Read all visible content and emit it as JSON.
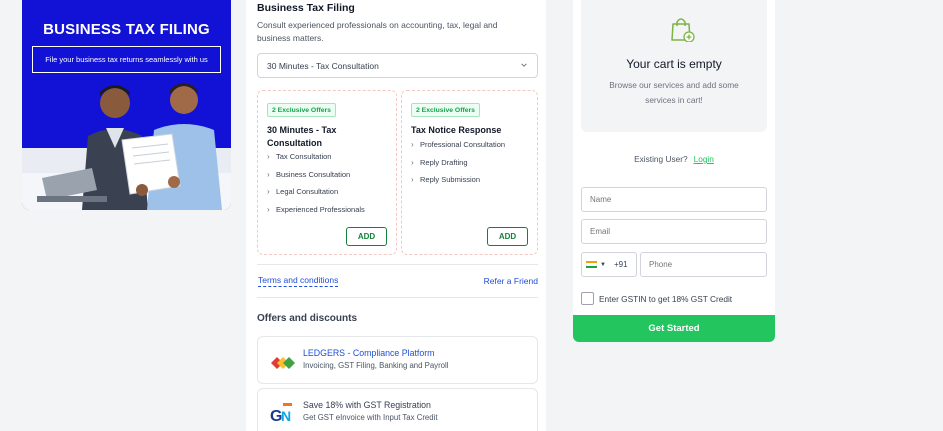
{
  "hero": {
    "title": "BUSINESS TAX FILING",
    "subtitle": "File your business tax returns seamlessly with us"
  },
  "service": {
    "title": "Business Tax Filing",
    "description": "Consult experienced professionals on accounting, tax, legal and business matters.",
    "selected_option": "30 Minutes - Tax Consultation"
  },
  "offer_cards": [
    {
      "badge": "2 Exclusive Offers",
      "title": "30 Minutes - Tax Consultation",
      "items": [
        "Tax Consultation",
        "Business Consultation",
        "Legal Consultation",
        "Experienced Professionals"
      ],
      "button": "ADD"
    },
    {
      "badge": "2 Exclusive Offers",
      "title": "Tax Notice Response",
      "items": [
        "Professional Consultation",
        "Reply Drafting",
        "Reply Submission"
      ],
      "button": "ADD"
    }
  ],
  "links": {
    "terms": "Terms and conditions",
    "refer": "Refer a Friend"
  },
  "offers": {
    "heading": "Offers and discounts",
    "items": [
      {
        "title": "LEDGERS - Compliance Platform",
        "subtitle": "Invoicing, GST Filing, Banking and Payroll",
        "icon": "ledgers-logo-icon"
      },
      {
        "title": "Save 18% with GST Registration",
        "subtitle": "Get GST eInvoice with Input Tax Credit",
        "icon": "gst-logo-icon"
      }
    ]
  },
  "cart": {
    "title": "Your cart is empty",
    "subtitle": "Browse our services and add some services in cart!",
    "icon": "shopping-bag-plus-icon"
  },
  "form": {
    "existing_user": "Existing User?",
    "login": "Login",
    "name_placeholder": "Name",
    "email_placeholder": "Email",
    "country_code": "+91",
    "phone_placeholder": "Phone",
    "gst_label": "Enter GSTIN to get 18% GST Credit",
    "submit": "Get Started"
  },
  "colors": {
    "hero_bg": "#1212d6",
    "accent_green": "#22c55e",
    "link_blue": "#1d4ed8"
  }
}
